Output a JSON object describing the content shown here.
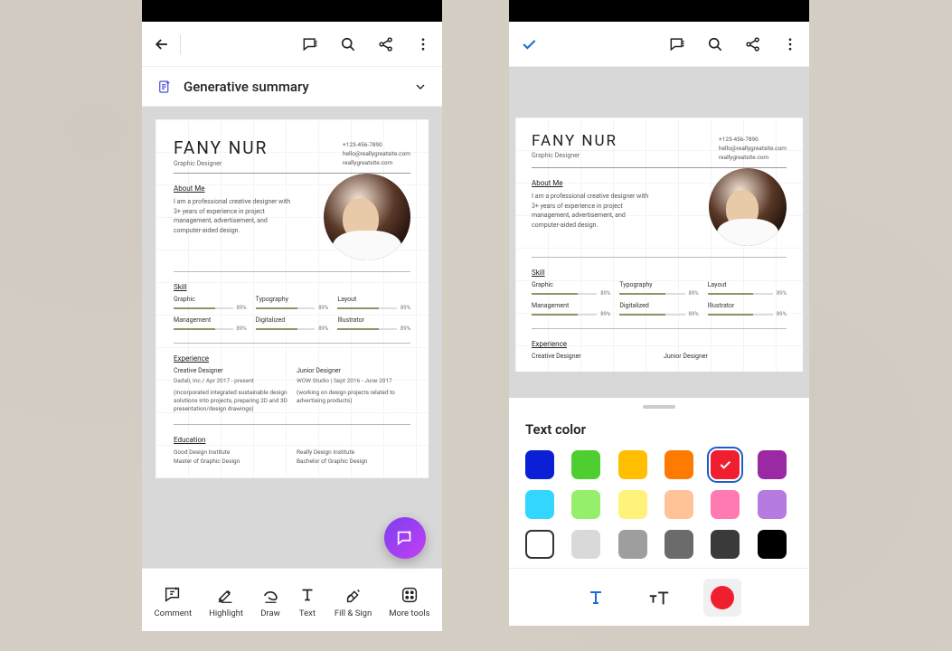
{
  "left": {
    "summary_label": "Generative summary",
    "tools": {
      "comment": "Comment",
      "highlight": "Highlight",
      "draw": "Draw",
      "text": "Text",
      "fillsign": "Fill & Sign",
      "more": "More tools"
    }
  },
  "right": {
    "panel_title": "Text color"
  },
  "resume": {
    "name": "FANY NUR",
    "subtitle": "Graphic Designer",
    "contact": {
      "phone": "+123-456-7890",
      "email": "hello@reallygreatsite.com",
      "site": "reallygreatsite.com"
    },
    "about_title": "About Me",
    "about_text": "I am a professional creative designer with 3+ years of experience in project management, advertisement, and computer-aided design.",
    "skill_title": "Skill",
    "skills": [
      {
        "name": "Graphic",
        "pct": "89%"
      },
      {
        "name": "Typography",
        "pct": "89%"
      },
      {
        "name": "Layout",
        "pct": "89%"
      },
      {
        "name": "Management",
        "pct": "89%"
      },
      {
        "name": "Digitalized",
        "pct": "89%"
      },
      {
        "name": "Illustrator",
        "pct": "89%"
      }
    ],
    "exp_title": "Experience",
    "exp": [
      {
        "role": "Creative Designer",
        "where": "Dadali, Inc./ Apr 2017 - present",
        "desc": "(incorporated integrated sustainable design solutions into projects, preparing 2D and 3D presentation/design drawings)"
      },
      {
        "role": "Junior Designer",
        "where": "WOW Studio | Sept 2016 - June 2017",
        "desc": "(working on design projects related to advertising products)"
      }
    ],
    "edu_title": "Education",
    "edu": [
      {
        "a": "Good Design Institute",
        "b": "Master of Graphic Design"
      },
      {
        "a": "Really Design Institute",
        "b": "Bachelor of Graphic Design"
      }
    ]
  },
  "colors": {
    "row1": [
      "#0b1fd6",
      "#4fce2f",
      "#ffbf00",
      "#ff7a00",
      "#ef1f2f",
      "#9a2aa3"
    ],
    "row2": [
      "#33d6ff",
      "#96ef6a",
      "#fff27a",
      "#ffc299",
      "#ff7ab0",
      "#b57be0"
    ],
    "row3": [
      "outline",
      "#d9d9d9",
      "#9e9e9e",
      "#6b6b6b",
      "#3a3a3a",
      "#000000"
    ],
    "selected_index": 4,
    "current": "#ef1f2f"
  }
}
